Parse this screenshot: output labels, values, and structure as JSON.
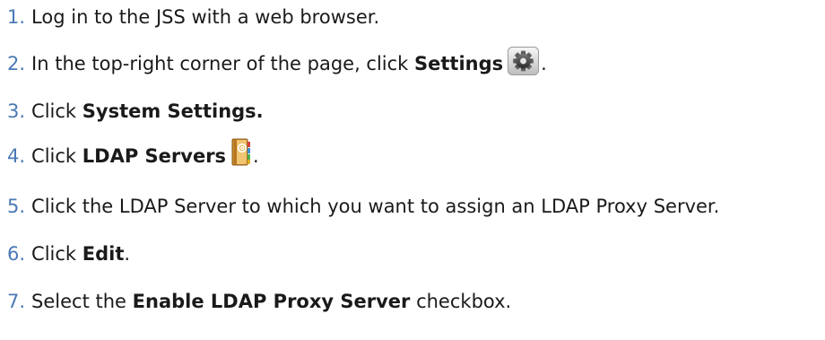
{
  "steps": [
    {
      "number": "1.",
      "parts": [
        "Log in to the JSS with a web browser."
      ]
    },
    {
      "number": "2.",
      "parts": [
        "In the top-right corner of the page, click ",
        "Settings",
        "."
      ],
      "icon": "settings-gear-icon"
    },
    {
      "number": "3.",
      "parts": [
        "Click ",
        "System Settings."
      ]
    },
    {
      "number": "4.",
      "parts": [
        "Click ",
        "LDAP Servers",
        "."
      ],
      "icon": "ldap-address-book-icon"
    },
    {
      "number": "5.",
      "parts": [
        "Click the LDAP Server to which you want to assign an LDAP Proxy Server."
      ]
    },
    {
      "number": "6.",
      "parts": [
        "Click ",
        "Edit",
        "."
      ]
    },
    {
      "number": "7.",
      "parts": [
        "Select the ",
        "Enable LDAP Proxy Server",
        " checkbox."
      ]
    }
  ],
  "colors": {
    "number": "#4a79b5",
    "text": "#1a1a1a"
  }
}
